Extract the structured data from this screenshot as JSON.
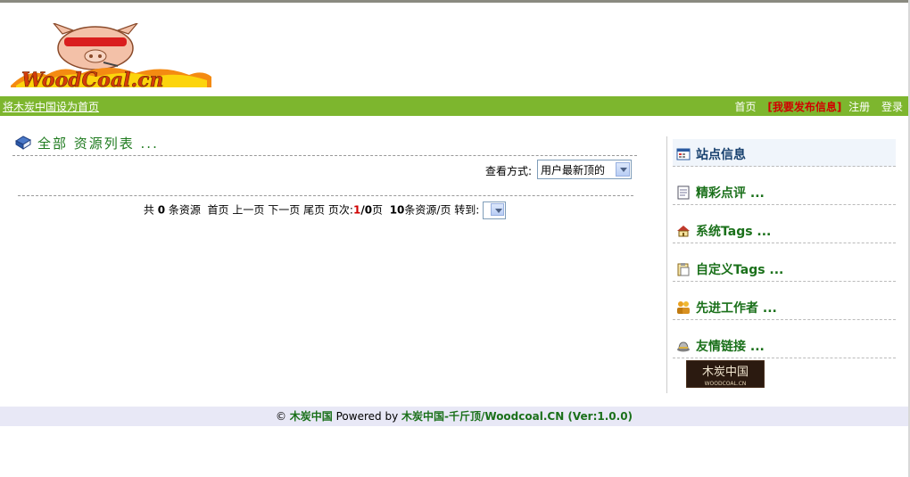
{
  "logo": {
    "text": "WoodCoal.cn"
  },
  "nav": {
    "set_home": "将木炭中国设为首页",
    "links": {
      "home": "首页",
      "publish": "[我要发布信息]",
      "register": "注册",
      "login": "登录"
    }
  },
  "main": {
    "title": "全部 资源列表 ...",
    "view_label": "查看方式:",
    "view_value": "用户最新顶的",
    "pager": {
      "total_prefix": "共",
      "total": "0",
      "total_suffix": "条资源",
      "first": "首页",
      "prev": "上一页",
      "next": "下一页",
      "last": "尾页",
      "page_label": "页次:",
      "page_current": "1",
      "page_sep": "/0",
      "page_unit": "页",
      "per_page": "10",
      "per_page_suffix": "条资源/页",
      "goto": "转到:"
    }
  },
  "sidebar": {
    "items": [
      {
        "label": "站点信息",
        "icon": "calendar-icon"
      },
      {
        "label": "精彩点评 ...",
        "icon": "document-icon"
      },
      {
        "label": "系统Tags ...",
        "icon": "home-icon"
      },
      {
        "label": "自定义Tags ...",
        "icon": "clipboard-icon"
      },
      {
        "label": "先进工作者 ...",
        "icon": "users-icon"
      },
      {
        "label": "友情链接 ...",
        "icon": "hat-icon"
      }
    ],
    "banner_text": "木炭中国",
    "banner_sub": "WOODCOAL.CN"
  },
  "footer": {
    "copyright": "©",
    "site": "木炭中国",
    "powered": "Powered by",
    "product": "木炭中国-千斤顶/Woodcoal.CN (Ver:1.0.0)"
  }
}
